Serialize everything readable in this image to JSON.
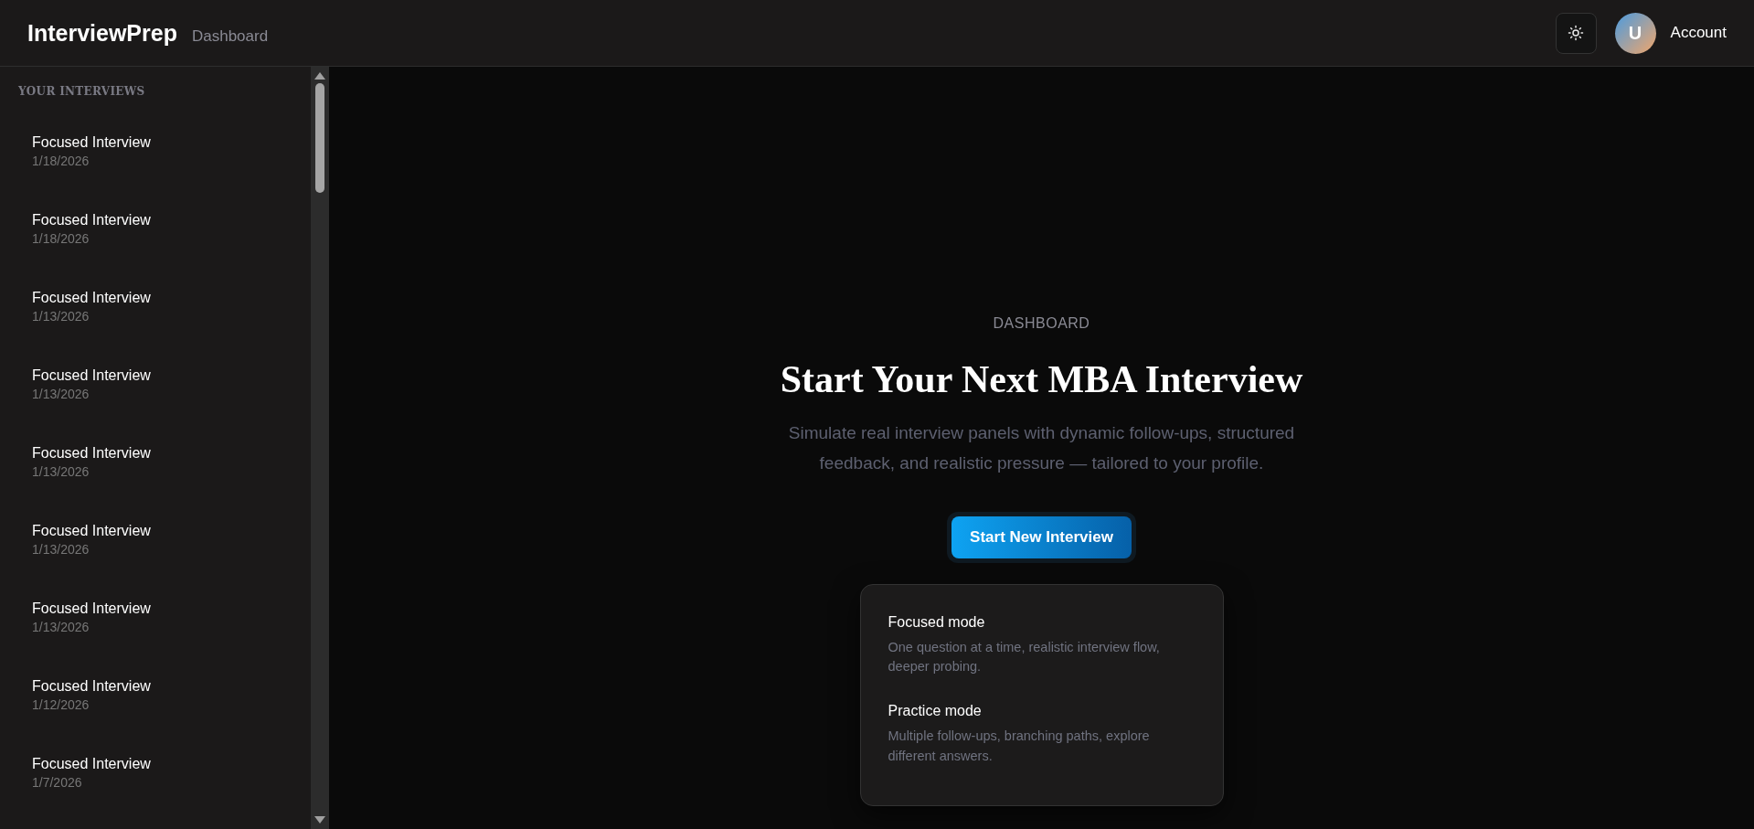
{
  "header": {
    "brand": "InterviewPrep",
    "page": "Dashboard",
    "avatar_letter": "U",
    "account": "Account"
  },
  "sidebar": {
    "heading": "YOUR INTERVIEWS",
    "items": [
      {
        "title": "Focused Interview",
        "date": "1/18/2026"
      },
      {
        "title": "Focused Interview",
        "date": "1/18/2026"
      },
      {
        "title": "Focused Interview",
        "date": "1/13/2026"
      },
      {
        "title": "Focused Interview",
        "date": "1/13/2026"
      },
      {
        "title": "Focused Interview",
        "date": "1/13/2026"
      },
      {
        "title": "Focused Interview",
        "date": "1/13/2026"
      },
      {
        "title": "Focused Interview",
        "date": "1/13/2026"
      },
      {
        "title": "Focused Interview",
        "date": "1/12/2026"
      },
      {
        "title": "Focused Interview",
        "date": "1/7/2026"
      }
    ]
  },
  "main": {
    "eyebrow": "DASHBOARD",
    "title": "Start Your Next MBA Interview",
    "subtitle": "Simulate real interview panels with dynamic follow-ups, structured feedback, and realistic pressure — tailored to your profile.",
    "button": "Start New Interview",
    "menu": [
      {
        "title": "Focused mode",
        "description": "One question at a time, realistic interview flow, deeper probing."
      },
      {
        "title": "Practice mode",
        "description": "Multiple follow-ups, branching paths, explore different answers."
      }
    ]
  }
}
